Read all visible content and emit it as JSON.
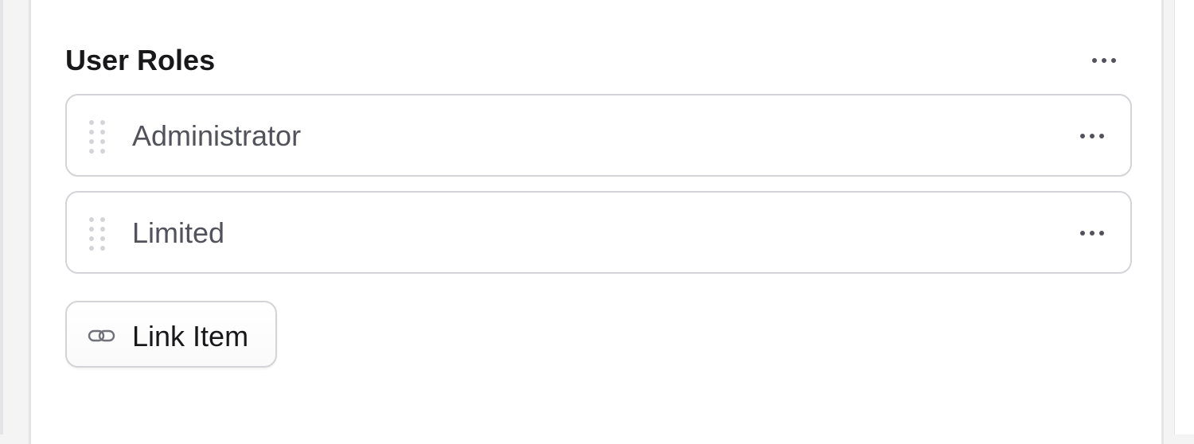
{
  "section": {
    "title": "User Roles"
  },
  "roles": [
    {
      "label": "Administrator"
    },
    {
      "label": "Limited"
    }
  ],
  "actions": {
    "link_item_label": "Link Item"
  },
  "icons": {
    "section_menu": "ellipsis-horizontal-icon",
    "row_menu": "ellipsis-horizontal-icon",
    "drag_handle": "drag-handle-icon",
    "link": "link-icon"
  },
  "colors": {
    "title_text": "#18181b",
    "row_text": "#52525b",
    "border": "#d4d4d8",
    "handle_dots": "#d4d4d8",
    "panel_edge": "#e4e4e7"
  }
}
